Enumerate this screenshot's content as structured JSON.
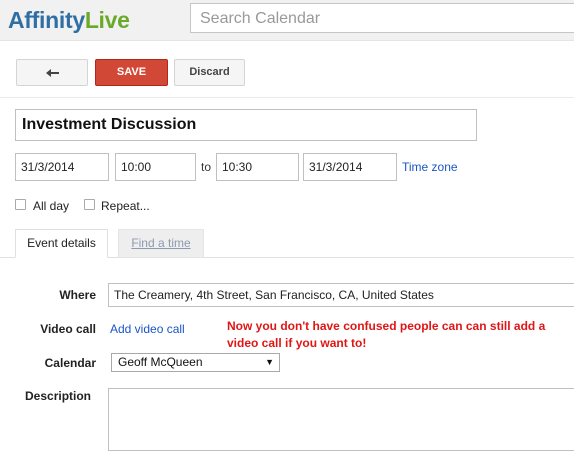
{
  "header": {
    "logo_part1": "Affinity",
    "logo_part2": "Live",
    "search_placeholder": "Search Calendar"
  },
  "toolbar": {
    "back_icon": "back-arrow-icon",
    "save_label": "SAVE",
    "discard_label": "Discard"
  },
  "event": {
    "title": "Investment Discussion",
    "start_date": "31/3/2014",
    "start_time": "10:00",
    "to_label": "to",
    "end_time": "10:30",
    "end_date": "31/3/2014",
    "timezone_link": "Time zone",
    "all_day_label": "All day",
    "all_day_checked": false,
    "repeat_label": "Repeat...",
    "repeat_checked": false
  },
  "tabs": [
    {
      "label": "Event details",
      "active": true
    },
    {
      "label": "Find a time",
      "active": false
    }
  ],
  "details": {
    "where_label": "Where",
    "where_value": "The Creamery, 4th Street, San Francisco, CA, United States",
    "video_label": "Video call",
    "video_link": "Add video call",
    "annotation": "Now you don't have confused people can can still add a video call if you want to!",
    "calendar_label": "Calendar",
    "calendar_value": "Geoff McQueen",
    "description_label": "Description",
    "description_value": ""
  },
  "colors": {
    "save_button": "#d14836",
    "link": "#1a56c6",
    "annotation": "#e01616",
    "logo_blue": "#2f6fa3",
    "logo_green": "#6aaa2a"
  }
}
